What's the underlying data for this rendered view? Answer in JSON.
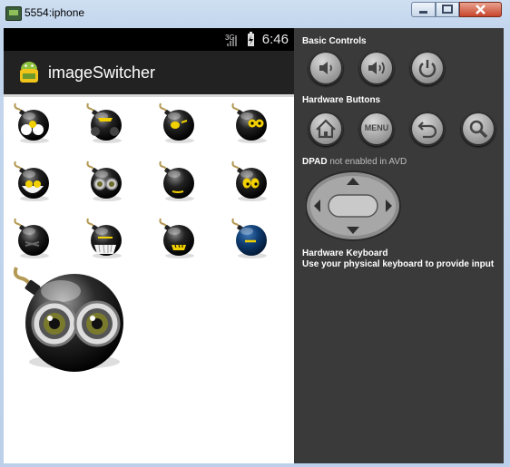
{
  "window": {
    "title": "5554:iphone"
  },
  "status_bar": {
    "time": "6:46",
    "network": "3G"
  },
  "app": {
    "title": "imageSwitcher"
  },
  "gallery": {
    "thumbnail_count": 12,
    "selected_index": 5
  },
  "panel": {
    "basic_controls": "Basic Controls",
    "hardware_buttons": "Hardware Buttons",
    "menu_label": "MENU",
    "dpad_title": "DPAD",
    "dpad_note": "not enabled in AVD",
    "keyboard_title": "Hardware Keyboard",
    "keyboard_note": "Use your physical keyboard to provide input"
  },
  "colors": {
    "action_bar": "#222222",
    "panel": "#3a3a3a",
    "bomb_alt_blue": "#0f3d73"
  },
  "icons": {
    "basic_controls": [
      "volume-down-icon",
      "volume-up-icon",
      "power-icon"
    ],
    "hardware_buttons": [
      "home-icon",
      "menu-button",
      "back-icon",
      "search-icon"
    ]
  }
}
